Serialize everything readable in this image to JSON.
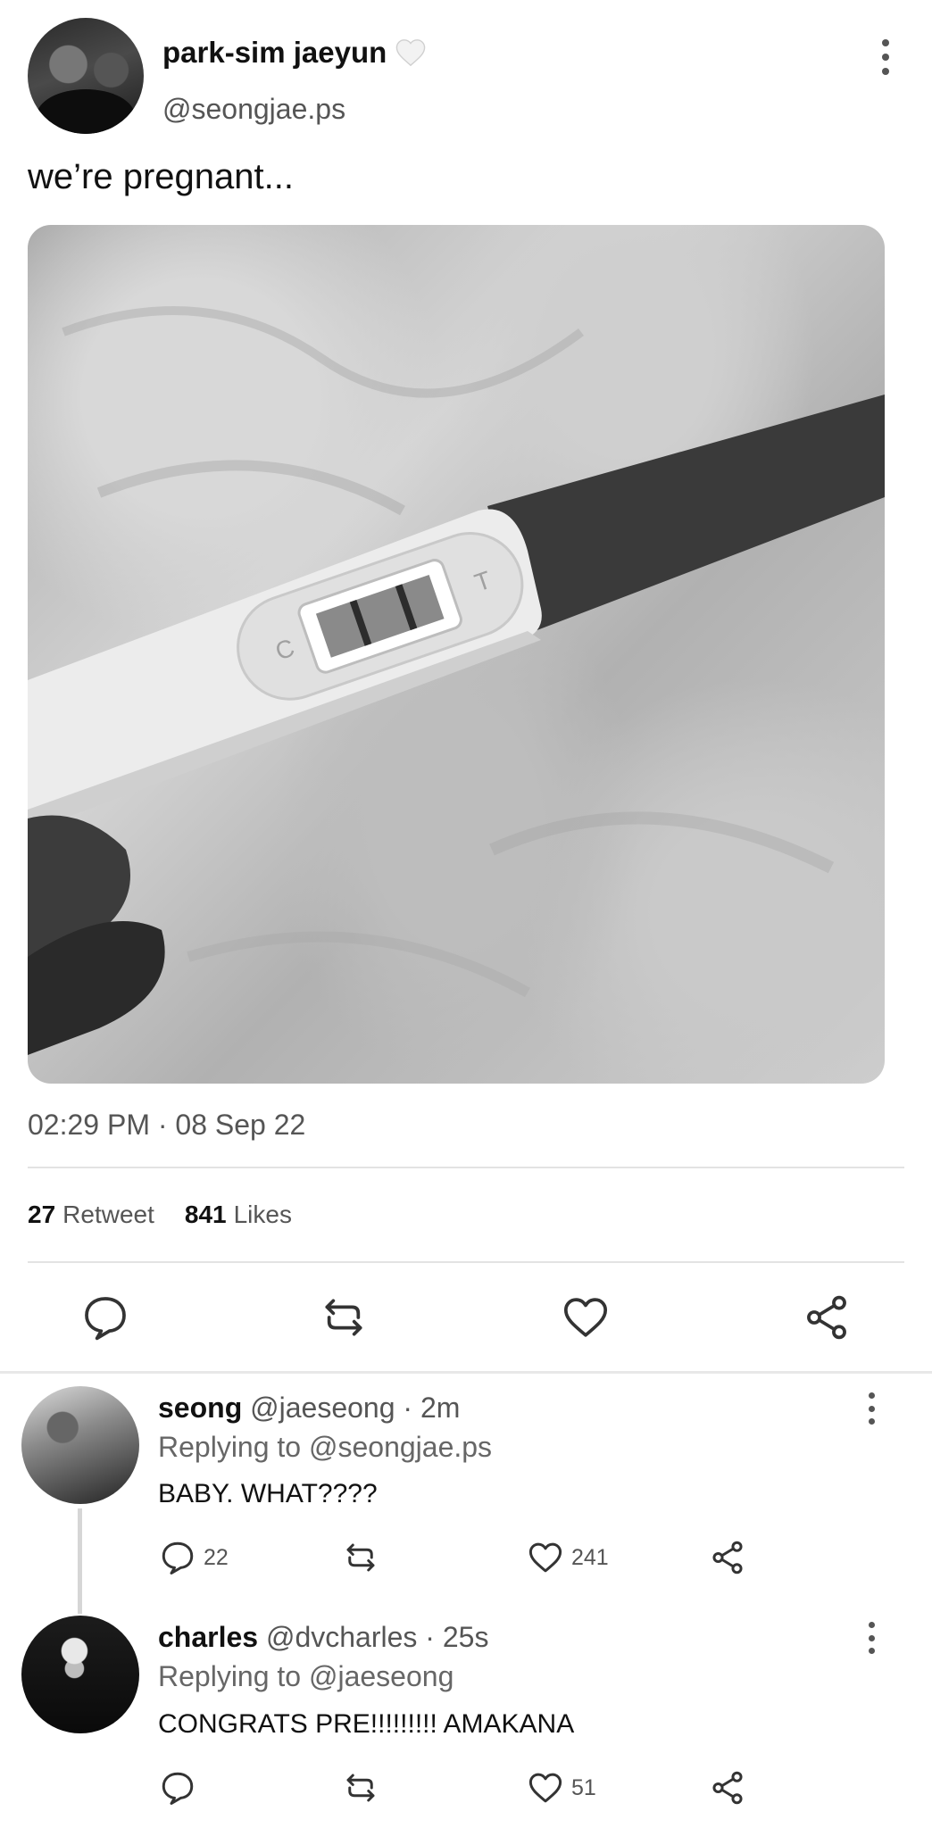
{
  "tweet": {
    "display_name": "park-sim jaeyun",
    "handle": "@seongjae.ps",
    "text": "we’re pregnant...",
    "timestamp": "02:29 PM · 08 Sep 22",
    "retweets": "27",
    "retweets_label": "Retweet",
    "likes": "841",
    "likes_label": "Likes",
    "badge_icon": "white-heart-icon",
    "photo_test_letters": {
      "c": "C",
      "t": "T"
    },
    "actions": [
      "reply-icon",
      "retweet-icon",
      "like-icon",
      "share-icon"
    ]
  },
  "replies": [
    {
      "name": "seong",
      "handle": "@jaeseong",
      "time": "· 2m",
      "replying_label": "Replying to",
      "replying_to": "@seongjae.ps",
      "text": "BABY. WHAT????",
      "reply_count": "22",
      "like_count": "241"
    },
    {
      "name": "charles",
      "handle": "@dvcharles",
      "time": "· 25s",
      "replying_label": "Replying to",
      "replying_to": "@jaeseong",
      "text": "CONGRATS PRE!!!!!!!!! AMAKANA",
      "like_count": "51"
    }
  ],
  "colors": {
    "text": "#111111",
    "secondary": "#555555",
    "divider": "#e3e3e3"
  }
}
